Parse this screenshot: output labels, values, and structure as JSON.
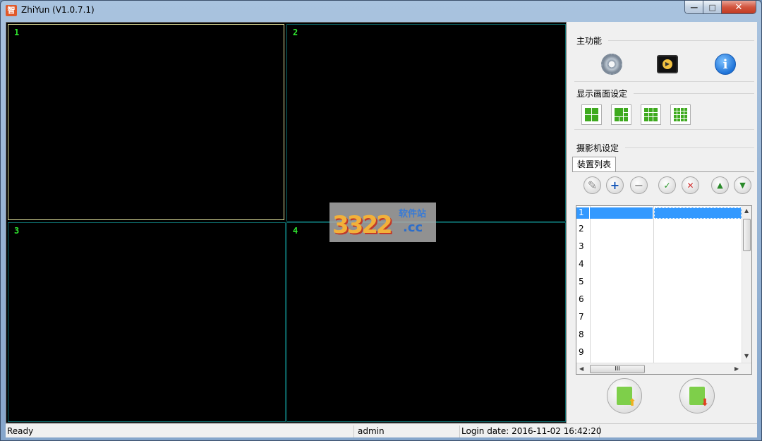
{
  "window": {
    "title": "ZhiYun (V1.0.7.1)",
    "app_icon_char": "智",
    "controls": {
      "minimize": "—",
      "maximize": "□",
      "close": "✕"
    }
  },
  "video": {
    "panes": [
      {
        "num": "1",
        "active": true
      },
      {
        "num": "2",
        "active": false
      },
      {
        "num": "3",
        "active": false
      },
      {
        "num": "4",
        "active": false
      }
    ],
    "watermark": {
      "big": "3322",
      "cc": ".cc",
      "site": "软件站"
    }
  },
  "side": {
    "main_functions": {
      "title": "主功能",
      "icons": [
        "gear-icon",
        "player-icon",
        "info-icon"
      ],
      "info_char": "i",
      "play_char": "▶"
    },
    "display": {
      "title": "显示画面设定",
      "layouts": [
        "2x2",
        "1+5",
        "3x3",
        "4x4"
      ]
    },
    "camera": {
      "title": "摄影机设定",
      "tab": "装置列表",
      "tools": [
        "edit",
        "add",
        "remove",
        "connect",
        "disconnect",
        "move-up",
        "move-down"
      ],
      "tool_glyphs": {
        "edit": "✎",
        "add": "+",
        "remove": "−",
        "connect": "✓",
        "disconnect": "✕",
        "up": "▲",
        "down": "▼"
      },
      "rows": [
        "1",
        "2",
        "3",
        "4",
        "5",
        "6",
        "7",
        "8",
        "9"
      ],
      "selected_row": "1",
      "scroll": {
        "up": "▲",
        "down": "▼",
        "left": "◀",
        "right": "▶",
        "thumb": "III"
      },
      "bottom_buttons": {
        "upload_arrow": "⬆",
        "download_arrow": "⬇"
      }
    }
  },
  "status": {
    "ready": "Ready",
    "user": "admin",
    "login": "Login date: 2016-11-02 16:42:20"
  },
  "colors": {
    "accent": "#3399ff",
    "pane_number": "#2fe62f",
    "layout_green": "#3eaa1e"
  }
}
